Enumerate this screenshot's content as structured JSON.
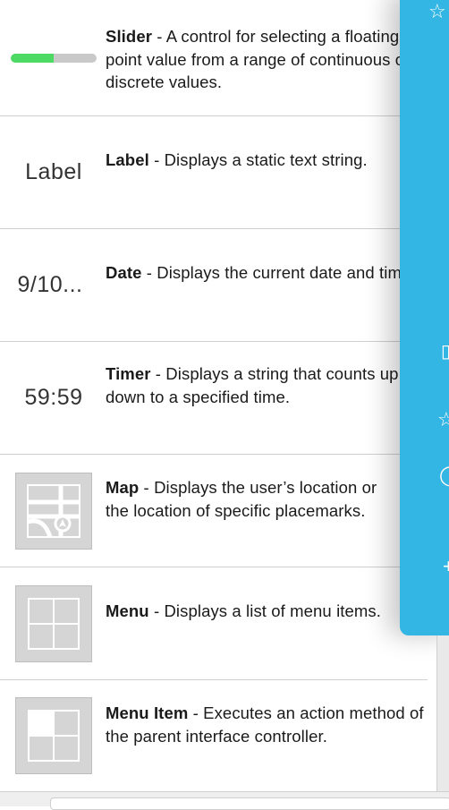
{
  "items": [
    {
      "name": "Slider",
      "sep": " - ",
      "desc": "A control for selecting a floating-point value from a range of continuous or discrete values.",
      "slider_level": 0.5
    },
    {
      "name": "Label",
      "sep": " - ",
      "desc": "Displays a static text string.",
      "thumb": "Label"
    },
    {
      "name": "Date",
      "sep": " - ",
      "desc": "Displays the current date and time.",
      "thumb": "9/10..."
    },
    {
      "name": "Timer",
      "sep": " - ",
      "desc": "Displays a string that counts up or down to a specified time.",
      "thumb": "59:59"
    },
    {
      "name": "Map",
      "sep": " - ",
      "desc": "Displays the user’s location or the location of specific placemarks."
    },
    {
      "name": "Menu",
      "sep": " - ",
      "desc": "Displays a list of menu items."
    },
    {
      "name": "Menu Item",
      "sep": " - ",
      "desc": "Executes an action method of the parent interface controller."
    }
  ],
  "colors": {
    "accent_panel": "#34b6e4",
    "slider_fill": "#4cd964",
    "slider_track": "#c9c9c9",
    "thumb_box": "#d5d5d5"
  },
  "icons": [
    "slider-thumbnail",
    "map-thumbnail",
    "menu-thumbnail",
    "menu-item-thumbnail"
  ]
}
